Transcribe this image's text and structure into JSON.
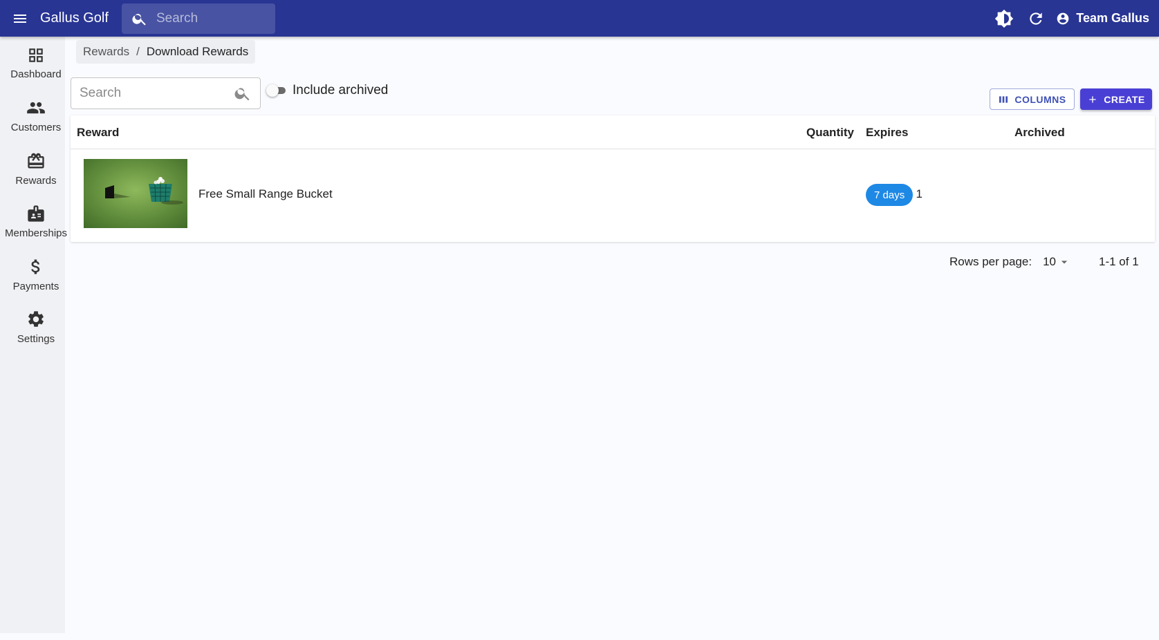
{
  "app": {
    "title": "Gallus Golf"
  },
  "topbar": {
    "search_placeholder": "Search",
    "user_name": "Team Gallus"
  },
  "sidebar": {
    "items": [
      {
        "label": "Dashboard",
        "icon": "dashboard-icon"
      },
      {
        "label": "Customers",
        "icon": "people-icon"
      },
      {
        "label": "Rewards",
        "icon": "gift-card-icon"
      },
      {
        "label": "Memberships",
        "icon": "badge-icon"
      },
      {
        "label": "Payments",
        "icon": "dollar-icon"
      },
      {
        "label": "Settings",
        "icon": "gear-icon"
      }
    ]
  },
  "breadcrumb": {
    "parent": "Rewards",
    "separator": "/",
    "current": "Download Rewards"
  },
  "toolbar": {
    "search_placeholder": "Search",
    "include_archived_label": "Include archived",
    "include_archived_checked": false,
    "columns_label": "COLUMNS",
    "create_label": "CREATE"
  },
  "table": {
    "columns": [
      "Reward",
      "Quantity",
      "Expires",
      "Archived"
    ],
    "rows": [
      {
        "reward": "Free Small Range Bucket",
        "quantity": "1",
        "expires": "7 days",
        "archived": ""
      }
    ]
  },
  "pagination": {
    "rows_per_page_label": "Rows per page:",
    "rows_per_page": "10",
    "range": "1-1 of 1"
  },
  "colors": {
    "appbar": "#283593",
    "primary": "#3f51b5",
    "create_button": "#4a3fd4",
    "chip": "#1e88e5",
    "sidebar": "#f0f1f4"
  }
}
